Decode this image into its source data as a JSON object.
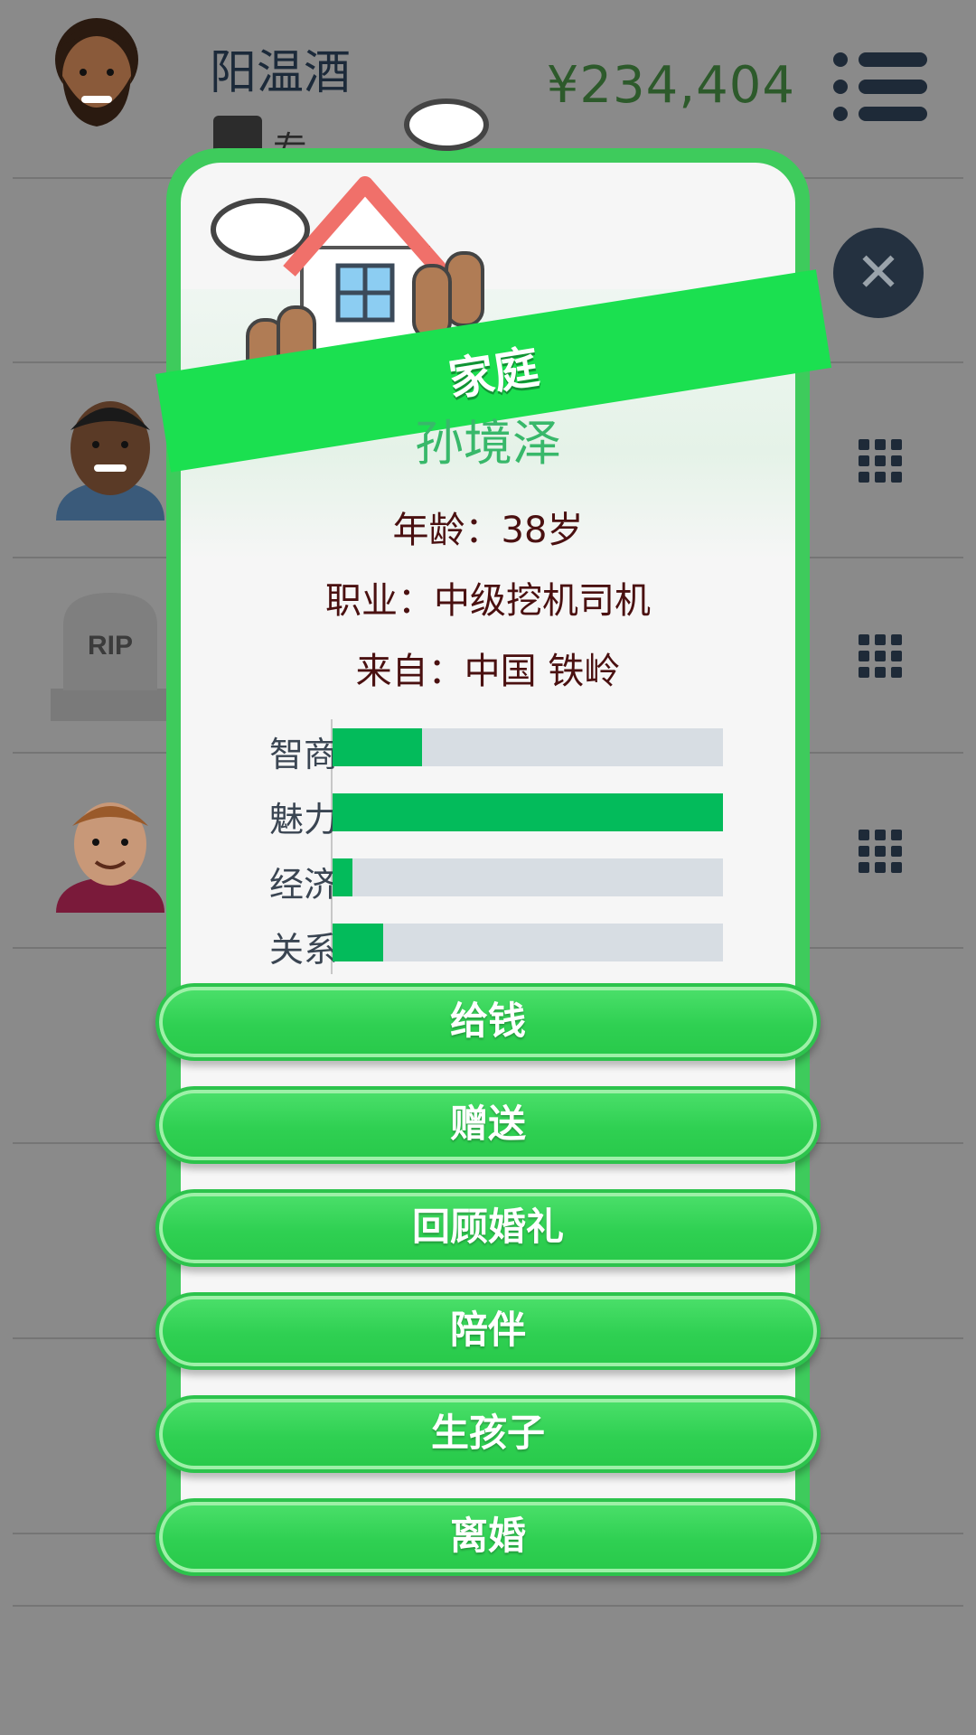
{
  "player": {
    "name": "阳温酒",
    "job_text": "专",
    "money": "¥234,404"
  },
  "modal": {
    "title": "家庭",
    "member": {
      "name": "孙境泽",
      "age_line": "年龄：38岁",
      "job_line": "职业：中级挖机司机",
      "from_line": "来自：中国 铁岭"
    },
    "stats": [
      {
        "label": "智商",
        "value": 0.23
      },
      {
        "label": "魅力",
        "value": 1.0
      },
      {
        "label": "经济",
        "value": 0.05
      },
      {
        "label": "关系",
        "value": 0.13
      }
    ],
    "actions": [
      "给钱",
      "赠送",
      "回顾婚礼",
      "陪伴",
      "生孩子",
      "离婚"
    ]
  },
  "background_list": {
    "rip_text": "RIP"
  },
  "colors": {
    "accent_green": "#1be050",
    "stat_fill": "#03bb5b",
    "money_green": "#2d5a2b"
  }
}
